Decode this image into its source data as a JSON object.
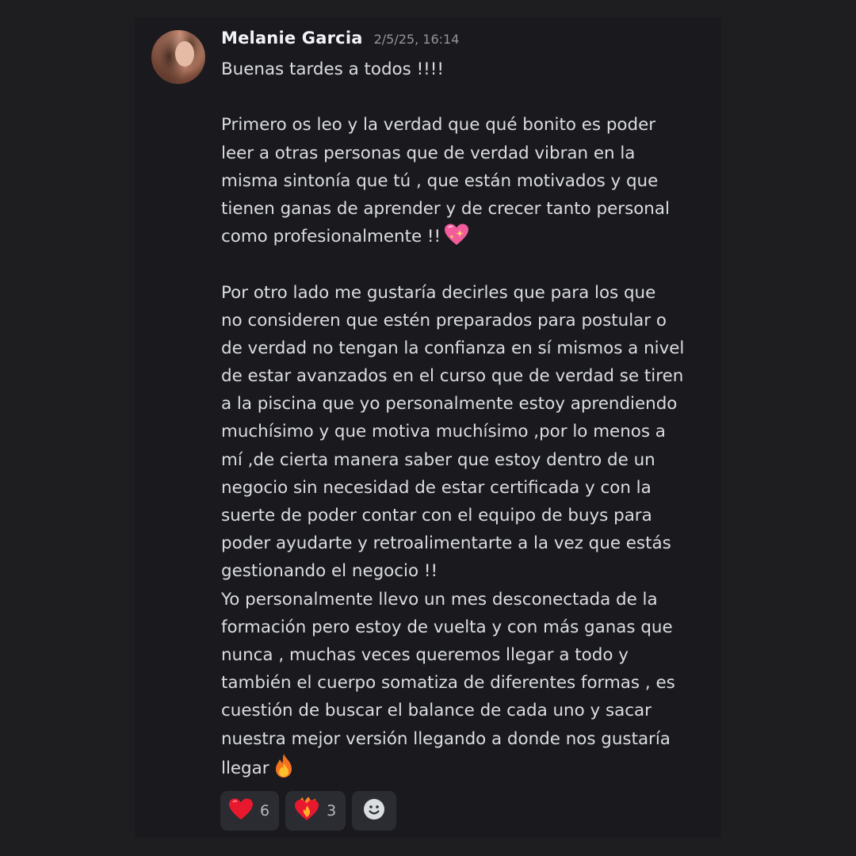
{
  "message": {
    "author": "Melanie Garcia",
    "timestamp": "2/5/25, 16:14",
    "lines": [
      "Buenas tardes a todos !!!!",
      "",
      "Primero os leo y la verdad que qué bonito es poder",
      "leer a otras personas que de verdad vibran en la",
      "misma sintonía que tú , que están motivados y que",
      "tienen ganas de aprender y de crecer tanto personal",
      "como profesionalmente !!",
      "",
      "Por otro lado me gustaría decirles que para los que",
      "no consideren que estén preparados para postular o",
      "de verdad no tengan la confianza en sí mismos a nivel",
      "de estar avanzados en el curso que de verdad se tiren",
      "a la piscina que yo personalmente estoy aprendiendo",
      "muchísimo y que motiva muchísimo ,por lo menos a",
      "mí ,de cierta manera saber que estoy dentro de un",
      "negocio sin necesidad de estar certificada y con la",
      "suerte de poder contar con el equipo de buys para",
      "poder ayudarte y retroalimentarte a la vez que estás",
      "gestionando el negocio !!",
      "Yo personalmente llevo un mes desconectada de la",
      "formación pero estoy de vuelta y con más ganas que",
      "nunca , muchas veces queremos llegar a todo y",
      "también el cuerpo somatiza de diferentes formas , es",
      "cuestión de buscar el balance de cada uno y sacar",
      "nuestra mejor versión llegando a donde nos gustaría",
      "llegar"
    ],
    "inline_emojis": {
      "line_6": "sparkling-heart",
      "line_25": "fire"
    }
  },
  "reactions": [
    {
      "emoji": "red-heart",
      "count": "6"
    },
    {
      "emoji": "heart-on-fire",
      "count": "3"
    }
  ],
  "add_reaction": {
    "icon": "smiley-add-reaction-icon"
  },
  "colors": {
    "background": "#1e1e21",
    "card": "#1a1a1e",
    "text": "#dbdee1",
    "username": "#f2f3f5",
    "timestamp": "#94959c",
    "reaction_bg": "#2b2c31"
  }
}
